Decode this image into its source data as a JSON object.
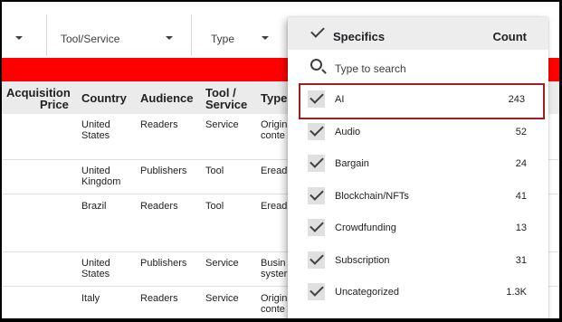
{
  "filters": [
    {
      "label": ""
    },
    {
      "label": "Tool/Service"
    },
    {
      "label": "Type"
    }
  ],
  "table": {
    "headers": {
      "acquisition_price_1": "Acquisition",
      "acquisition_price_2": "Price",
      "country": "Country",
      "audience": "Audience",
      "tool_service_1": "Tool /",
      "tool_service_2": "Service",
      "type": "Type"
    },
    "rows": [
      {
        "country": [
          "United",
          "States"
        ],
        "audience": "Readers",
        "tool": "Service",
        "type": [
          "Origin",
          "conte"
        ]
      },
      {
        "country": [
          "United",
          "Kingdom"
        ],
        "audience": "Publishers",
        "tool": "Tool",
        "type": [
          "Eread",
          ""
        ]
      },
      {
        "country": [
          "Brazil",
          ""
        ],
        "audience": "Readers",
        "tool": "Tool",
        "type": [
          "Eread",
          ""
        ]
      },
      {
        "country": [
          "United",
          "States"
        ],
        "audience": "Publishers",
        "tool": "Service",
        "type": [
          "Busin",
          "syster"
        ]
      },
      {
        "country": [
          "Italy",
          ""
        ],
        "audience": "Readers",
        "tool": "Service",
        "type": [
          "Origin",
          "conte"
        ]
      }
    ]
  },
  "dropdown": {
    "title": "Specifics",
    "count_header": "Count",
    "search_placeholder": "Type to search",
    "items": [
      {
        "label": "AI",
        "count": "243",
        "checked": true,
        "highlighted": true
      },
      {
        "label": "Audio",
        "count": "52",
        "checked": true
      },
      {
        "label": "Bargain",
        "count": "24",
        "checked": true
      },
      {
        "label": "Blockchain/NFTs",
        "count": "41",
        "checked": true
      },
      {
        "label": "Crowdfunding",
        "count": "13",
        "checked": true
      },
      {
        "label": "Subscription",
        "count": "31",
        "checked": true
      },
      {
        "label": "Uncategorized",
        "count": "1.3K",
        "checked": true
      }
    ]
  },
  "colors": {
    "banner": "#ff0000",
    "highlight_border": "#a61c1c",
    "header_bg": "#ebebeb"
  }
}
